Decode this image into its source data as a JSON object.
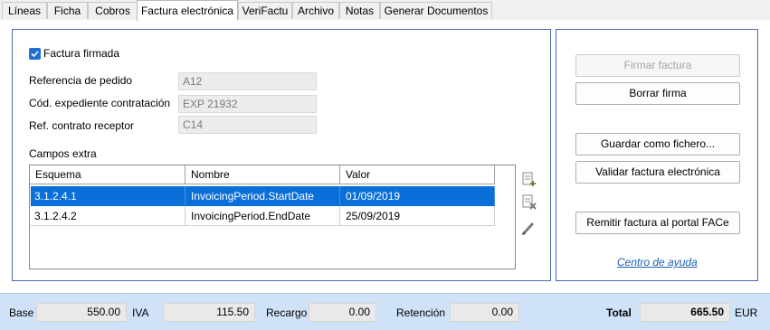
{
  "tabs": [
    {
      "label": "Líneas"
    },
    {
      "label": "Ficha"
    },
    {
      "label": "Cobros"
    },
    {
      "label": "Factura electrónica"
    },
    {
      "label": "VeriFactu"
    },
    {
      "label": "Archivo"
    },
    {
      "label": "Notas"
    },
    {
      "label": "Generar Documentos"
    }
  ],
  "signed": {
    "label": "Factura firmada",
    "checked": true
  },
  "fields": {
    "order_ref": {
      "label": "Referencia de pedido",
      "value": "A12"
    },
    "file_code": {
      "label": "Cód. expediente contratación",
      "value": "EXP 21932"
    },
    "contract_ref": {
      "label": "Ref. contrato receptor",
      "value": "C14"
    }
  },
  "extra": {
    "title": "Campos extra",
    "columns": [
      "Esquema",
      "Nombre",
      "Valor"
    ],
    "rows": [
      {
        "schema": "3.1.2.4.1",
        "name": "InvoicingPeriod.StartDate",
        "value": "01/09/2019",
        "selected": true
      },
      {
        "schema": "3.1.2.4.2",
        "name": "InvoicingPeriod.EndDate",
        "value": "25/09/2019",
        "selected": false
      }
    ],
    "icons": [
      "add-row-icon",
      "delete-row-icon",
      "edit-icon"
    ]
  },
  "actions": {
    "sign": "Firmar factura",
    "erase": "Borrar firma",
    "save": "Guardar como fichero...",
    "validate": "Validar factura electrónica",
    "send": "Remitir factura al portal FACe",
    "help": "Centro de ayuda"
  },
  "totals": {
    "base_label": "Base",
    "base": "550.00",
    "iva_label": "IVA",
    "iva": "115.50",
    "recargo_label": "Recargo",
    "recargo": "0.00",
    "retencion_label": "Retención",
    "retencion": "0.00",
    "total_label": "Total",
    "total": "665.50",
    "currency": "EUR"
  },
  "colors": {
    "accent": "#0a6fd8",
    "footer": "#cfe2f8",
    "panel_border": "#4a6aa8"
  }
}
